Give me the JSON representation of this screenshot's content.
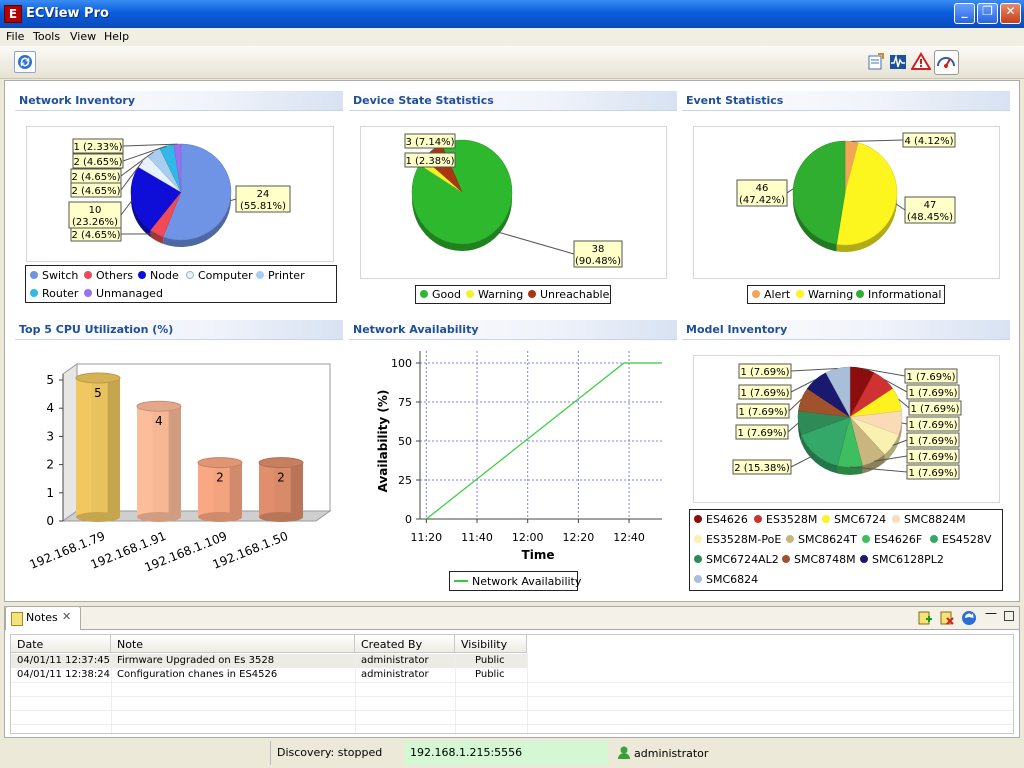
{
  "window": {
    "title": "ECView Pro",
    "logo": "E",
    "min_label": "_",
    "max_label": "❐",
    "close_label": "✕"
  },
  "menu": {
    "items": [
      "File",
      "Tools",
      "View",
      "Help"
    ]
  },
  "toolbar": {
    "left_icon": "refresh-icon",
    "right_icons": [
      "export-icon",
      "graph-icon",
      "alert-icon",
      "dashboard-icon"
    ]
  },
  "panels": {
    "network_inventory": {
      "title": "Network Inventory"
    },
    "device_state": {
      "title": "Device State Statistics"
    },
    "event_stats": {
      "title": "Event Statistics"
    },
    "cpu": {
      "title": "Top 5 CPU Utilization (%)"
    },
    "availability": {
      "title": "Network Availability"
    },
    "model_inventory": {
      "title": "Model Inventory"
    }
  },
  "chart_data": [
    {
      "type": "pie",
      "id": "network_inventory",
      "labels": [
        "Switch",
        "Others",
        "Node",
        "Computer",
        "Printer",
        "Router",
        "Unmanaged"
      ],
      "values": [
        24,
        2,
        10,
        2,
        2,
        2,
        1
      ],
      "callouts": [
        "24\n(55.81%)",
        "2 (4.65%)",
        "10\n(23.26%)",
        "2 (4.65%)",
        "2 (4.65%)",
        "2 (4.65%)",
        "1 (2.33%)"
      ],
      "colors": [
        "#6f94e6",
        "#ef4a55",
        "#0e0ed8",
        "#e6f2ff",
        "#a9cdee",
        "#2fb8e8",
        "#9a70f0"
      ]
    },
    {
      "type": "pie",
      "id": "device_state",
      "labels": [
        "Good",
        "Warning",
        "Unreachable"
      ],
      "values": [
        38,
        1,
        3
      ],
      "callouts": [
        "38\n(90.48%)",
        "1 (2.38%)",
        "3 (7.14%)"
      ],
      "colors": [
        "#2eb82e",
        "#f4f12a",
        "#a8360e"
      ]
    },
    {
      "type": "pie",
      "id": "event_stats",
      "labels": [
        "Alert",
        "Warning",
        "Informational"
      ],
      "values": [
        4,
        47,
        46
      ],
      "callouts": [
        "4 (4.12%)",
        "47\n(48.45%)",
        "46\n(47.42%)"
      ],
      "colors": [
        "#f3a35a",
        "#fdf51e",
        "#2fae2f"
      ]
    },
    {
      "type": "bar",
      "id": "cpu",
      "categories": [
        "192.168.1.79",
        "192.168.1.91",
        "192.168.1.109",
        "192.168.1.50"
      ],
      "values": [
        5,
        4,
        2,
        2
      ],
      "ylim": [
        0,
        5
      ],
      "yticks": [
        0,
        1,
        2,
        3,
        4,
        5
      ],
      "colors": [
        "#e8c25c",
        "#f6b795",
        "#f3a37e",
        "#d98a68"
      ]
    },
    {
      "type": "line",
      "id": "availability",
      "x": [
        "11:20",
        "12:38",
        "12:53"
      ],
      "y": [
        0,
        100,
        100
      ],
      "xticks": [
        "11:20",
        "11:40",
        "12:00",
        "12:20",
        "12:40"
      ],
      "yticks": [
        0,
        25,
        50,
        75,
        100
      ],
      "ylim": [
        0,
        100
      ],
      "xlabel": "Time",
      "ylabel": "Availability (%)",
      "series_name": "Network Availability",
      "color": "#33cc33"
    },
    {
      "type": "pie",
      "id": "model_inventory",
      "labels": [
        "ES4626",
        "ES3528M",
        "SMC6724",
        "SMC8824M",
        "ES3528M-PoE",
        "SMC8624T",
        "ES4626F",
        "ES4528V",
        "SMC6724AL2",
        "SMC8748M",
        "SMC6128PL2",
        "SMC6824"
      ],
      "values": [
        1,
        1,
        1,
        1,
        1,
        1,
        1,
        2,
        1,
        1,
        1,
        1
      ],
      "callouts": [
        "1 (7.69%)",
        "1 (7.69%)",
        "1 (7.69%)",
        "1 (7.69%)",
        "1 (7.69%)",
        "1 (7.69%)",
        "1 (7.69%)",
        "2 (15.38%)",
        "1 (7.69%)",
        "1 (7.69%)",
        "1 (7.69%)",
        "1 (7.69%)"
      ],
      "colors": [
        "#8b0d0d",
        "#cf3232",
        "#fdf21f",
        "#fadbb8",
        "#faf0b0",
        "#c9b67f",
        "#3fbe60",
        "#34a868",
        "#2e8b57",
        "#a0522d",
        "#191970",
        "#a9bed8"
      ]
    }
  ],
  "notes": {
    "tab_label": "Notes",
    "columns": [
      "Date",
      "Note",
      "Created By",
      "Visibility"
    ],
    "rows": [
      [
        "04/01/11 12:37:45",
        "Firmware Upgraded on Es 3528",
        "administrator",
        "Public"
      ],
      [
        "04/01/11 12:38:24",
        "Configuration chanes in ES4526",
        "administrator",
        "Public"
      ]
    ]
  },
  "status": {
    "discovery": "Discovery: stopped",
    "server": "192.168.1.215:5556",
    "user": "administrator"
  }
}
